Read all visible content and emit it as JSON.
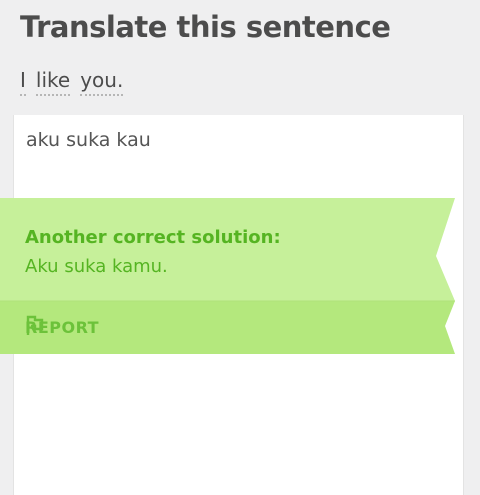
{
  "header": {
    "title": "Translate this sentence"
  },
  "prompt": {
    "words": [
      "I",
      "like",
      "you."
    ]
  },
  "answer": {
    "text": "aku suka kau"
  },
  "feedback": {
    "heading": "Another correct solution:",
    "solution": "Aku suka kamu.",
    "report_label": "REPORT",
    "report_icon": "flag-icon"
  },
  "colors": {
    "background": "#efeff0",
    "ribbon_light": "#c6f09a",
    "ribbon_dark": "#b4e87d",
    "green_text": "#55b422"
  }
}
